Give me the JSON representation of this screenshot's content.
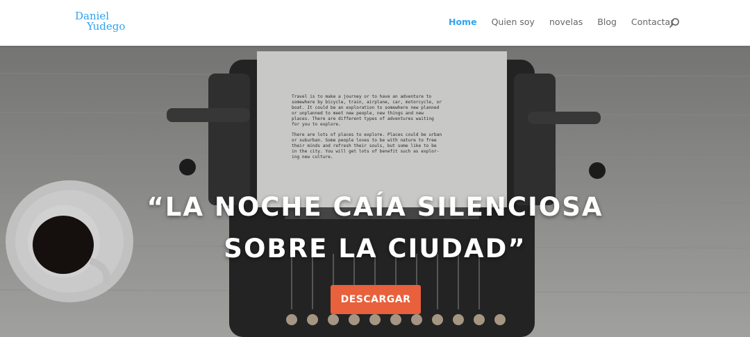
{
  "header": {
    "logo": {
      "line1": "Daniel",
      "line2": "Yudego"
    },
    "nav": {
      "items": [
        {
          "label": "Home"
        },
        {
          "label": "Quien soy"
        },
        {
          "label": "novelas"
        },
        {
          "label": "Blog"
        },
        {
          "label": "Contactar"
        }
      ],
      "active_index": 0
    },
    "search_icon": "search-icon"
  },
  "hero": {
    "paper_text": {
      "lines": [
        "Travel is to make a journey or to have an adventure to",
        "somewhere by bicycle, train, airplane, car, motorcycle, or",
        "boat. It could be an exploration to somewhere new planned",
        "or unplanned to meet new people, new things and new",
        "places. There are different types of adventures waiting",
        "for you to explore.",
        "",
        "There are lots of places to explore. Places could be urban",
        "or suburban. Some people loves to be with nature to free",
        "their minds and refresh their souls, but some like to be",
        "in the city. You will get lots of benefit such as explor-",
        "ing new culture."
      ]
    },
    "quote": {
      "line1": "“LA NOCHE CAÍA SILENCIOSA",
      "line2": "SOBRE LA CIUDAD”"
    },
    "cta_label": "DESCARGAR"
  },
  "colors": {
    "accent": "#2ea3f2",
    "nav_text": "#666666",
    "cta": "#e8603c"
  }
}
